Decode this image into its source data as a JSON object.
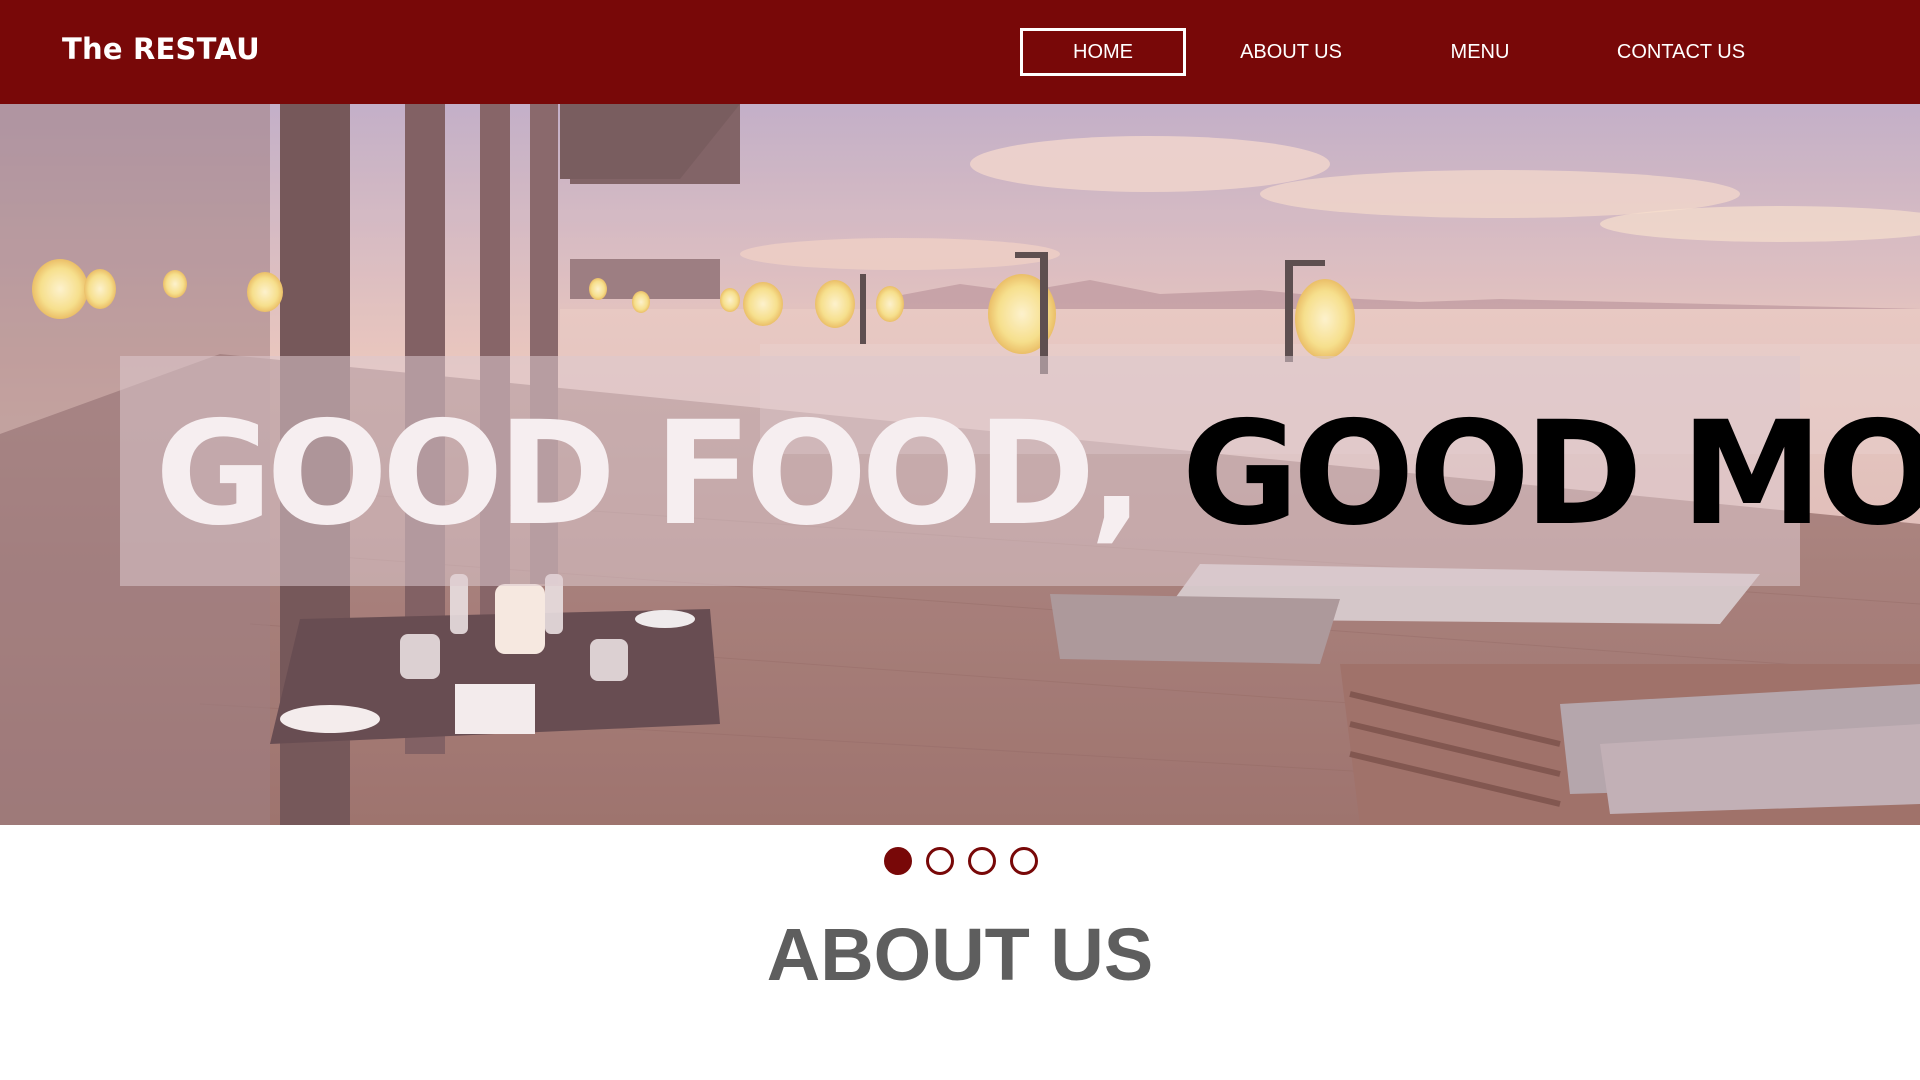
{
  "header": {
    "brand": "The RESTAU",
    "nav": [
      {
        "label": "HOME",
        "active": true
      },
      {
        "label": "ABOUT US",
        "active": false
      },
      {
        "label": "MENU",
        "active": false
      },
      {
        "label": "CONTACT US",
        "active": false
      }
    ],
    "colors": {
      "bar": "#780808",
      "text": "#ffffff"
    }
  },
  "hero": {
    "tagline_part1": "GOOD FOOD,",
    "tagline_part2": "GOOD MOOD.",
    "image_description_icon": "restaurant-terrace-sunset-photo"
  },
  "carousel": {
    "slide_count": 4,
    "active_index": 0
  },
  "about": {
    "heading": "ABOUT US"
  }
}
